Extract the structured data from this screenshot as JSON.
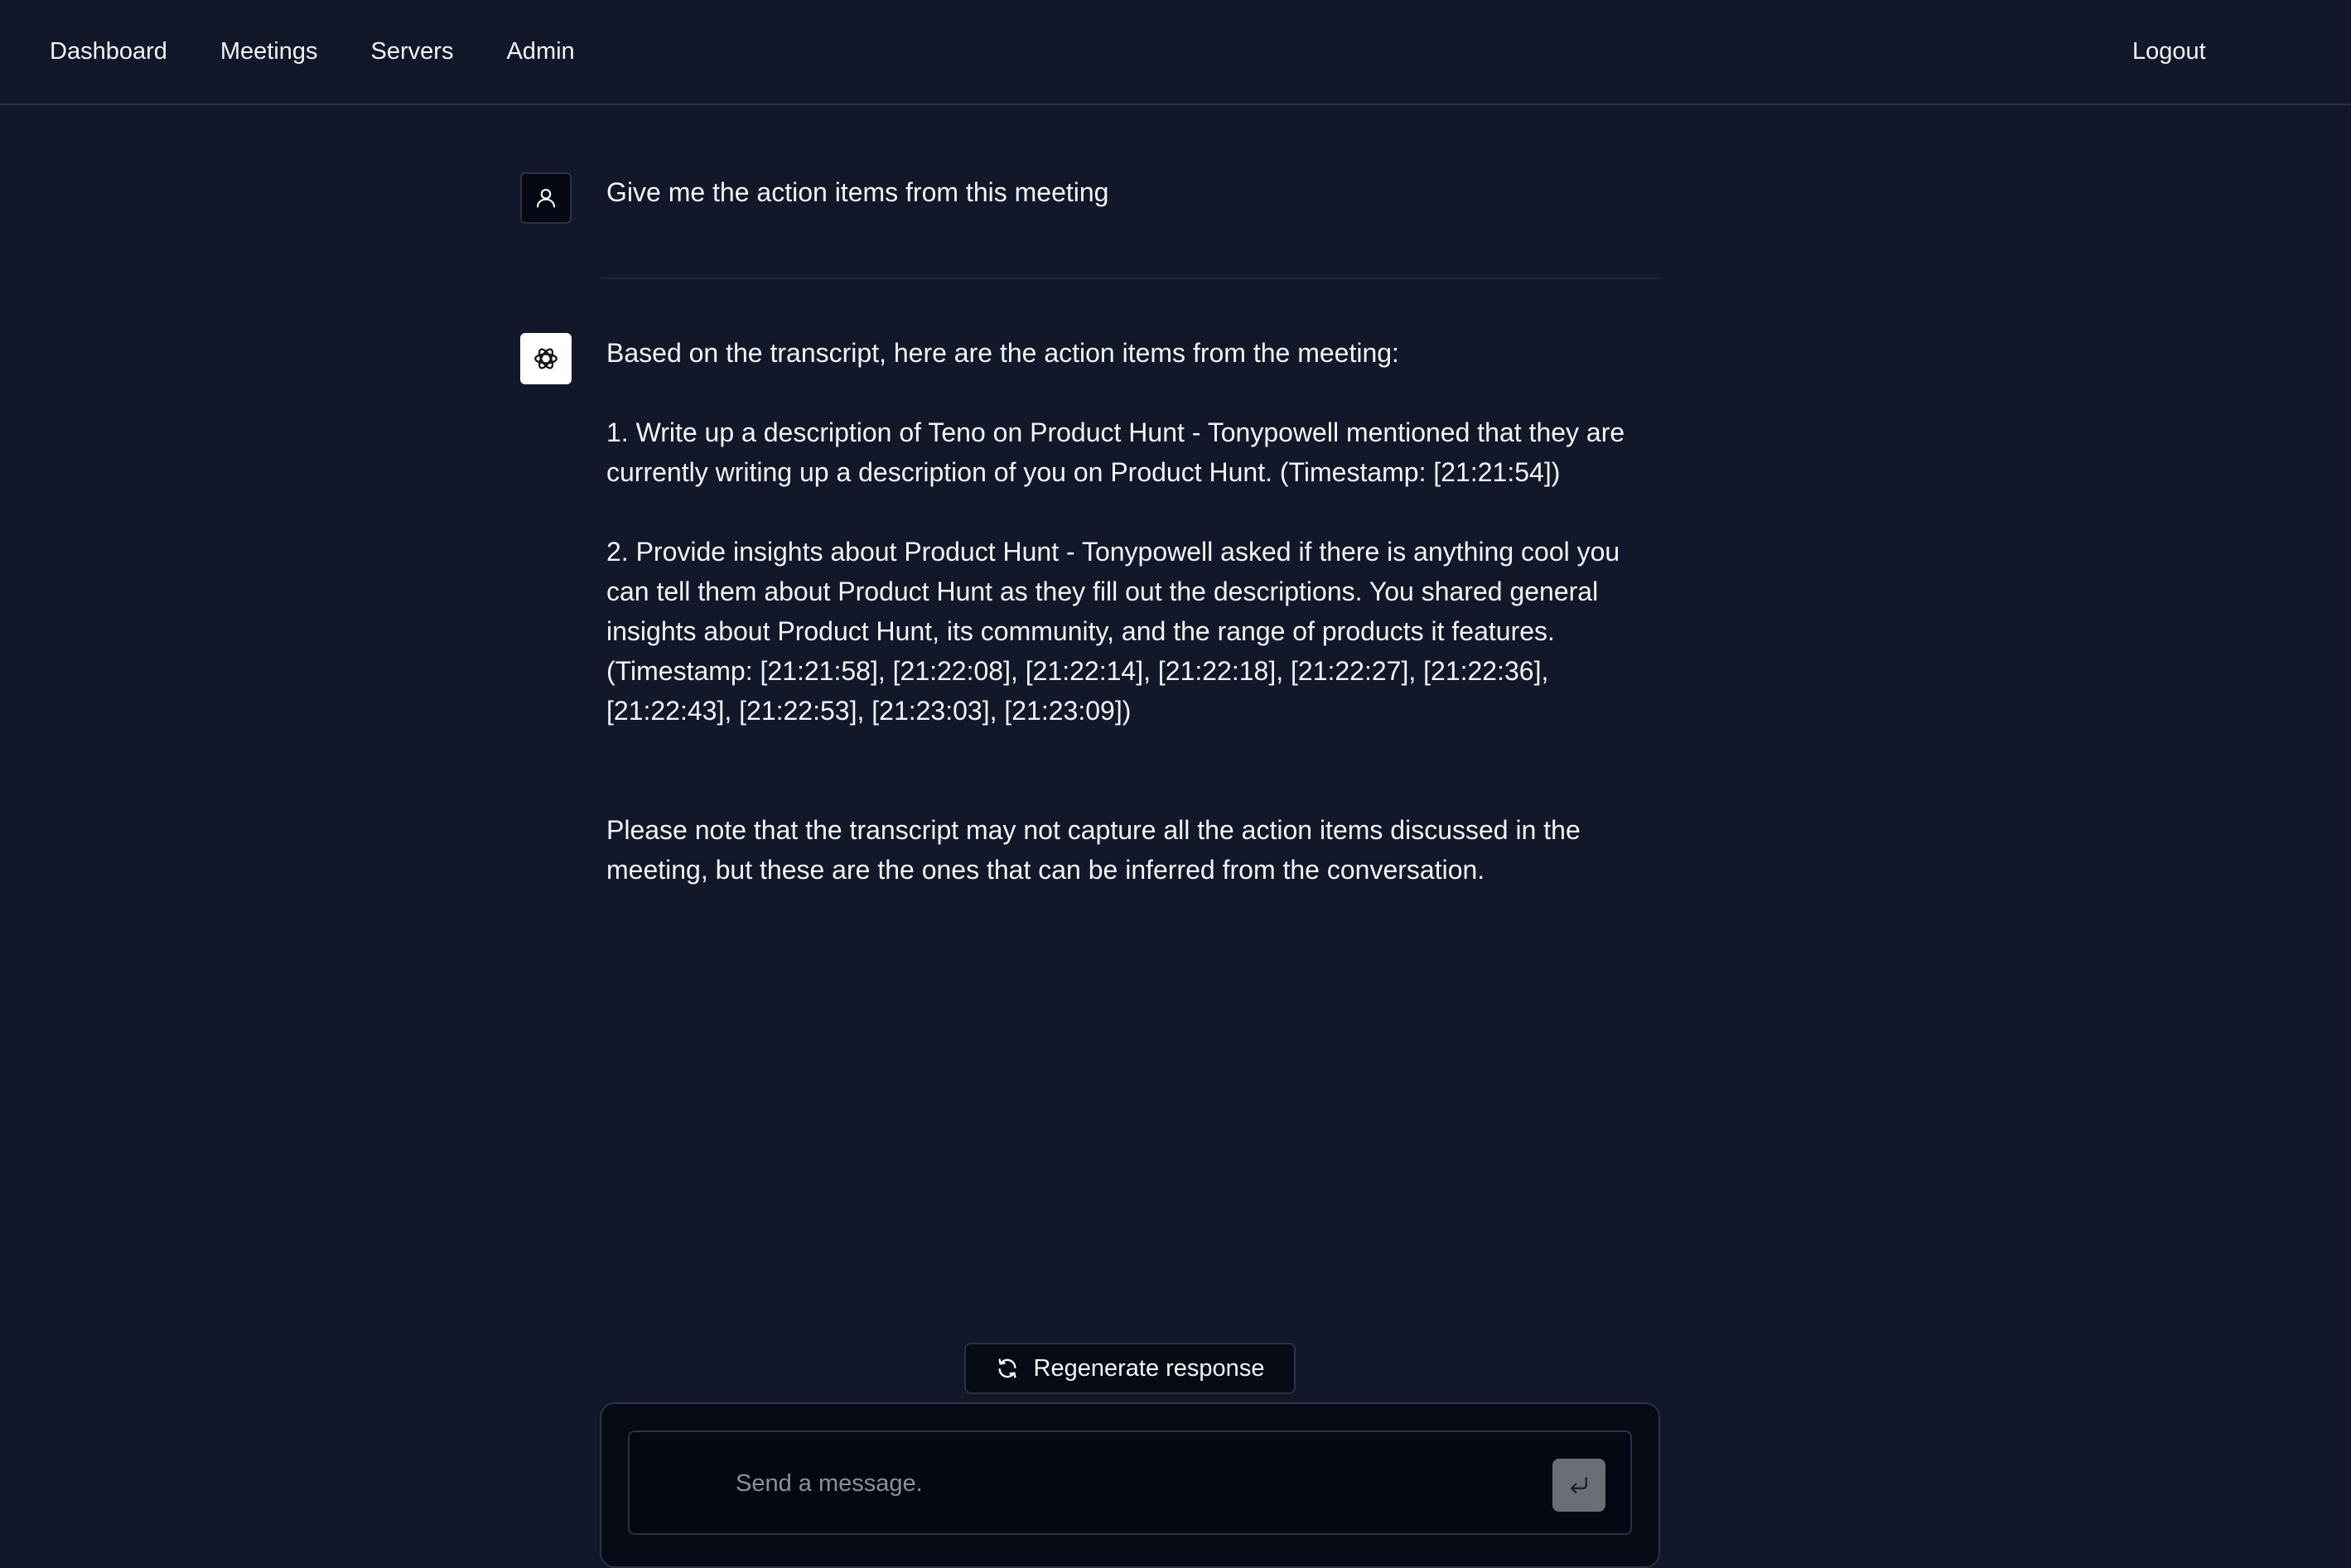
{
  "nav": {
    "items": [
      "Dashboard",
      "Meetings",
      "Servers",
      "Admin"
    ],
    "logout": "Logout"
  },
  "conversation": {
    "user_message": "Give me the action items from this meeting",
    "bot_intro": "Based on the transcript, here are the action items from the meeting:",
    "bot_item1": "1. Write up a description of Teno on Product Hunt - Tonypowell mentioned that they are currently writing up a description of you on Product Hunt. (Timestamp: [21:21:54])",
    "bot_item2": "2. Provide insights about Product Hunt - Tonypowell asked if there is anything cool you can tell them about Product Hunt as they fill out the descriptions. You shared general insights about Product Hunt, its community, and the range of products it features. (Timestamp: [21:21:58], [21:22:08], [21:22:14], [21:22:18], [21:22:27], [21:22:36], [21:22:43], [21:22:53], [21:23:03], [21:23:09])",
    "bot_note": "Please note that the transcript may not capture all the action items discussed in the meeting, but these are the ones that can be inferred from the conversation."
  },
  "composer": {
    "regenerate_label": "Regenerate response",
    "placeholder": "Send a message."
  },
  "icons": {
    "user_avatar": "user-icon",
    "bot_avatar": "openai-logo-icon",
    "regenerate": "refresh-icon",
    "send": "enter-icon"
  },
  "colors": {
    "background": "#121829",
    "send_button": "#6b6e75"
  }
}
